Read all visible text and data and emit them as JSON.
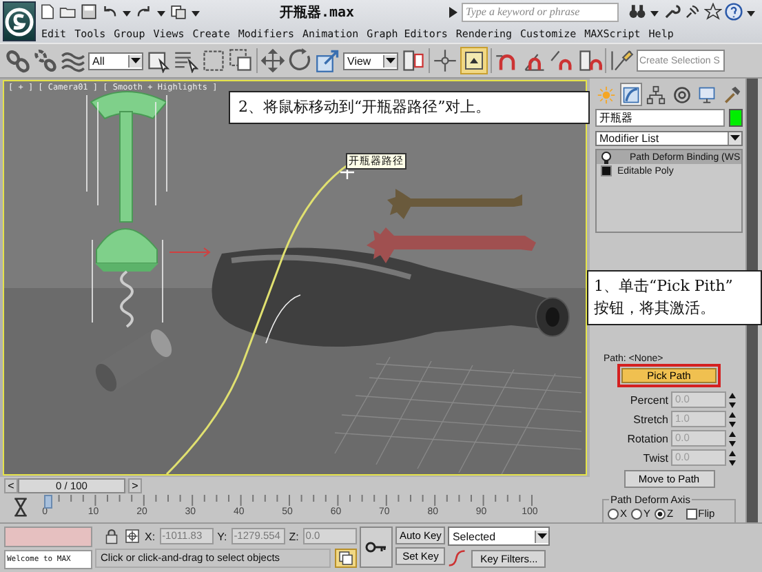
{
  "title_bar": {
    "title": "开瓶器.max",
    "search": {
      "placeholder": "Type a keyword or phrase"
    }
  },
  "menu": [
    "Edit",
    "Tools",
    "Group",
    "Views",
    "Create",
    "Modifiers",
    "Animation",
    "Graph Editors",
    "Rendering",
    "Customize",
    "MAXScript",
    "Help"
  ],
  "toolbar": {
    "selection_filter": "All",
    "reference_coordinate": "View",
    "named_selection": {
      "placeholder": "Create Selection S"
    }
  },
  "viewport": {
    "label": "[ + ] [ Camera01 ] [ Smooth + Highlights ]",
    "tooltip": "开瓶器路径"
  },
  "annotations": [
    {
      "text": "2、将鼠标移动到“开瓶器路径”对上。"
    },
    {
      "text": "1、单击“Pick Pith”\n按钮，将其激活。"
    }
  ],
  "command_panel": {
    "tabs": [
      {
        "selected": false
      },
      {
        "selected": true
      },
      {
        "selected": false
      },
      {
        "selected": false
      },
      {
        "selected": false
      },
      {
        "selected": false
      }
    ],
    "object_name": "开瓶器",
    "modifier_list": "Modifier List",
    "stack": [
      {
        "label": "Path Deform Binding (WS",
        "kind": "modifier",
        "selected": true
      },
      {
        "label": "Editable Poly",
        "kind": "object",
        "selected": false
      }
    ],
    "path_label": "Path: <None>",
    "pick_path": "Pick Path",
    "parameters": [
      {
        "label": "Percent",
        "value": "0.0",
        "disabled": true
      },
      {
        "label": "Stretch",
        "value": "1.0",
        "disabled": true
      },
      {
        "label": "Rotation",
        "value": "0.0",
        "disabled": true
      },
      {
        "label": "Twist",
        "value": "0.0",
        "disabled": true
      }
    ],
    "move_to_path": "Move to Path",
    "axis_group": {
      "title": "Path Deform Axis",
      "options": [
        {
          "label": "X",
          "selected": false
        },
        {
          "label": "Y",
          "selected": false
        },
        {
          "label": "Z",
          "selected": true
        }
      ],
      "flip": {
        "label": "Flip",
        "checked": false
      }
    }
  },
  "time_slider": {
    "position": "0 / 100",
    "level": 0,
    "prev": "<",
    "next": ">"
  },
  "track_bar": {
    "ticks": [
      "0",
      "10",
      "20",
      "30",
      "40",
      "50",
      "60",
      "70",
      "80",
      "90",
      "100"
    ]
  },
  "status_bar": {
    "listener": "Welcome to MAX",
    "coords": [
      {
        "axis": "X:",
        "value": "-1011.83"
      },
      {
        "axis": "Y:",
        "value": "-1279.554"
      },
      {
        "axis": "Z:",
        "value": "0.0"
      }
    ],
    "prompt": "Click or click-and-drag to select objects",
    "auto_key": "Auto Key",
    "set_key": "Set Key",
    "key_mode": "Selected",
    "key_filters": "Key Filters..."
  }
}
